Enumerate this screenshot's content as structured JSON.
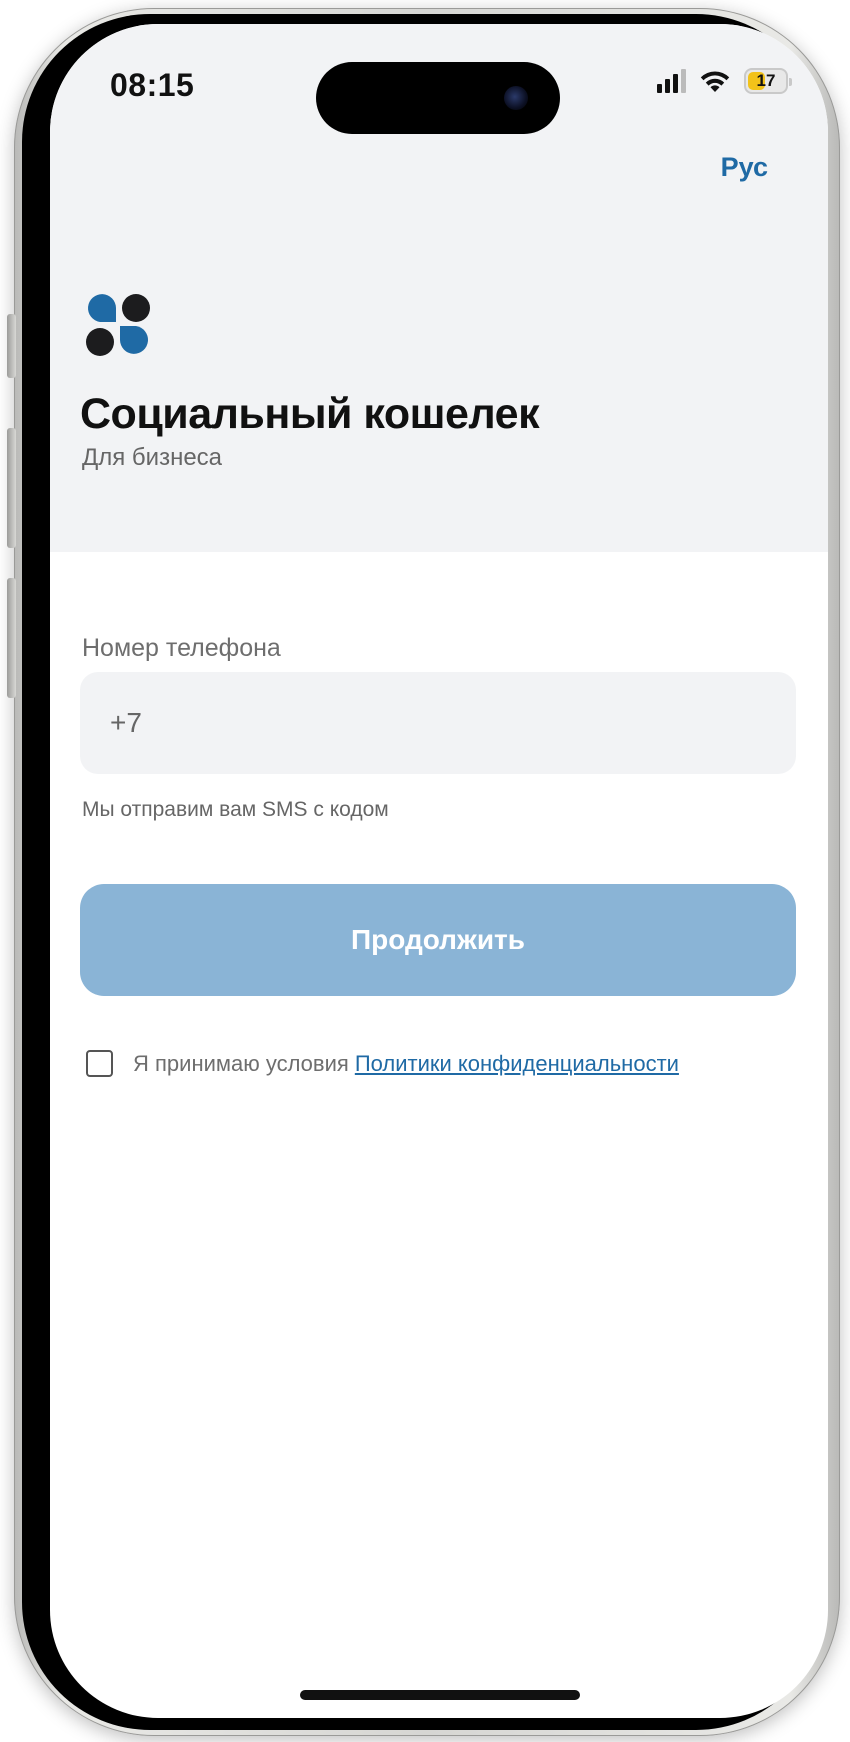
{
  "status_bar": {
    "time": "08:15",
    "battery_level": "17",
    "icons": [
      "cellular-signal-icon",
      "wifi-icon",
      "battery-icon"
    ]
  },
  "header": {
    "language": "Рус",
    "app_title": "Социальный кошелек",
    "app_subtitle": "Для бизнеса"
  },
  "form": {
    "phone_label": "Номер телефона",
    "phone_value": "",
    "phone_placeholder": "+7",
    "hint": "Мы отправим вам SMS с кодом",
    "continue_label": "Продолжить",
    "terms_text": "Я принимаю условия",
    "terms_link": "Политики конфиденциальности",
    "terms_checked": false
  },
  "colors": {
    "accent": "#1f6aa5",
    "button_disabled": "#8ab4d6",
    "logo_blue": "#1f6aa5",
    "logo_dark": "#1c1c1e",
    "header_bg": "#f2f3f5"
  }
}
